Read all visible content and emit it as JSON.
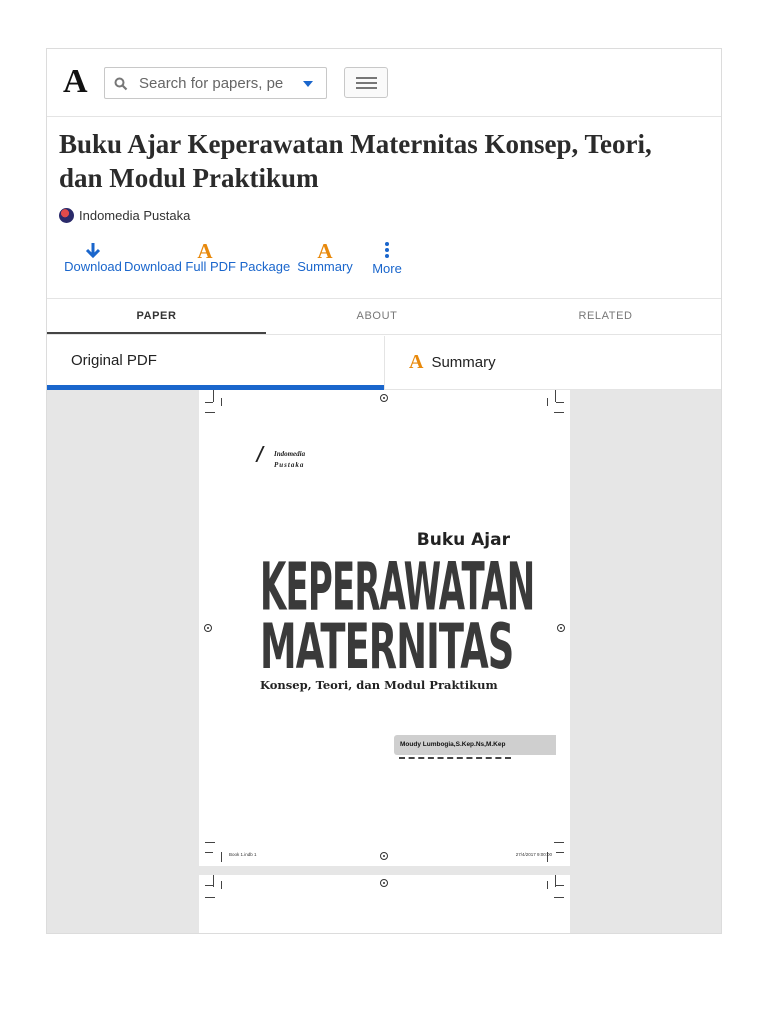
{
  "header": {
    "logo": "A",
    "search_placeholder": "Search for papers, pe"
  },
  "paper": {
    "title": "Buku Ajar Keperawatan Maternitas Konsep, Teori, dan Modul Praktikum",
    "author": "Indomedia Pustaka"
  },
  "actions": {
    "download": "Download",
    "download_full": "Download Full PDF Package",
    "summary": "Summary",
    "more": "More",
    "summary_glyph": "A"
  },
  "tabs": [
    "PAPER",
    "ABOUT",
    "RELATED"
  ],
  "view": {
    "original": "Original PDF",
    "summary": "Summary",
    "summary_glyph": "A"
  },
  "cover": {
    "publisher_line1": "Indomedia",
    "publisher_line2": "Pustaka",
    "buku_ajar": "Buku Ajar",
    "line1": "KEPERAWATAN",
    "line2": "MATERNITAS",
    "subtitle": "Konsep, Teori, dan Modul Praktikum",
    "author": "Moudy Lumbogia,S.Kep.Ns,M.Kep",
    "footer_left": "Book 1.indb   1",
    "footer_right": "27/4/2017   9:00:00"
  },
  "colors": {
    "accent": "#1a66cc",
    "summary_orange": "#e8890c"
  }
}
